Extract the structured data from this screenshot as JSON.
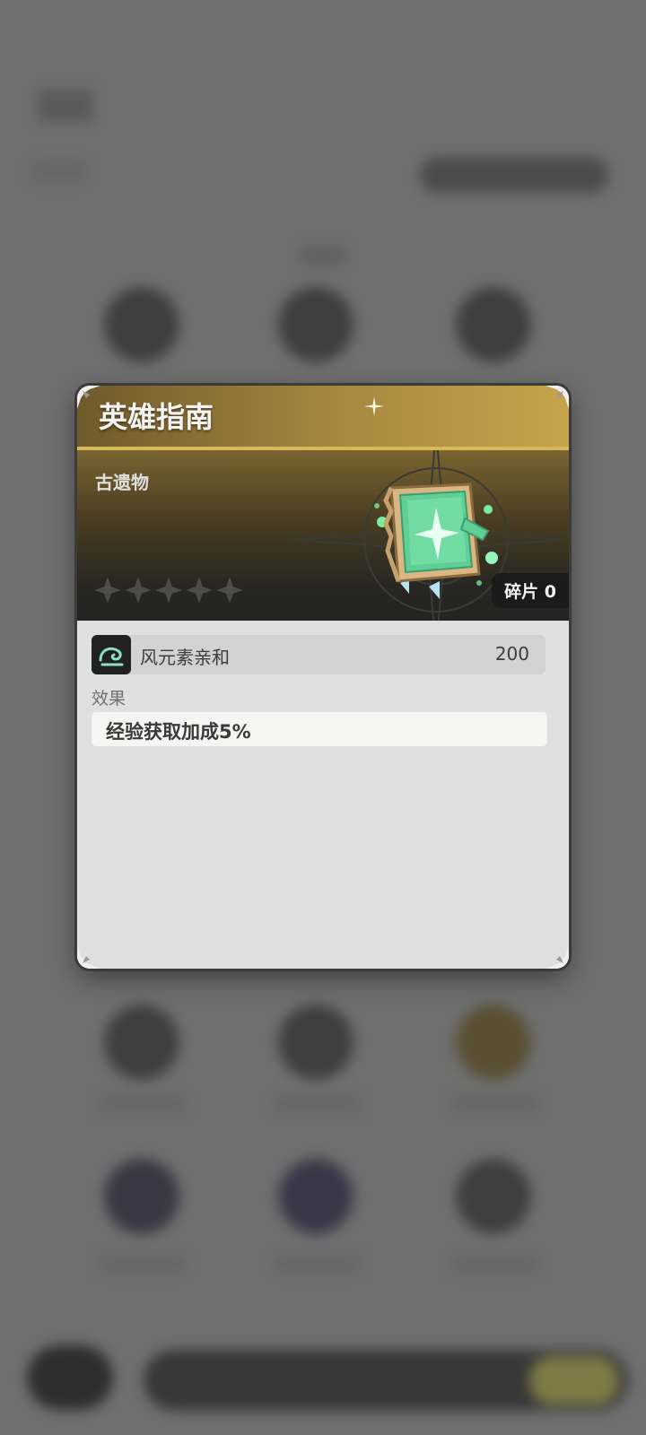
{
  "modal": {
    "title": "英雄指南",
    "category": "古遗物",
    "rarity_stars": 5,
    "filled_stars": 0,
    "shard_label": "碎片 0",
    "stat": {
      "name": "风元素亲和",
      "value": "200"
    },
    "effect_label": "效果",
    "effect_text": "经验获取加成5%"
  },
  "icons": {
    "item": "green-book-icon",
    "stat": "wind-element-icon",
    "star": "star-icon",
    "corner": "corner-ornament-icon",
    "sparkle": "sparkle-icon"
  },
  "colors": {
    "header_gold": "#c6a44d",
    "card_bg": "#e0e0e0",
    "star_empty": "#4c4c4c",
    "book_green": "#5fcf95"
  }
}
